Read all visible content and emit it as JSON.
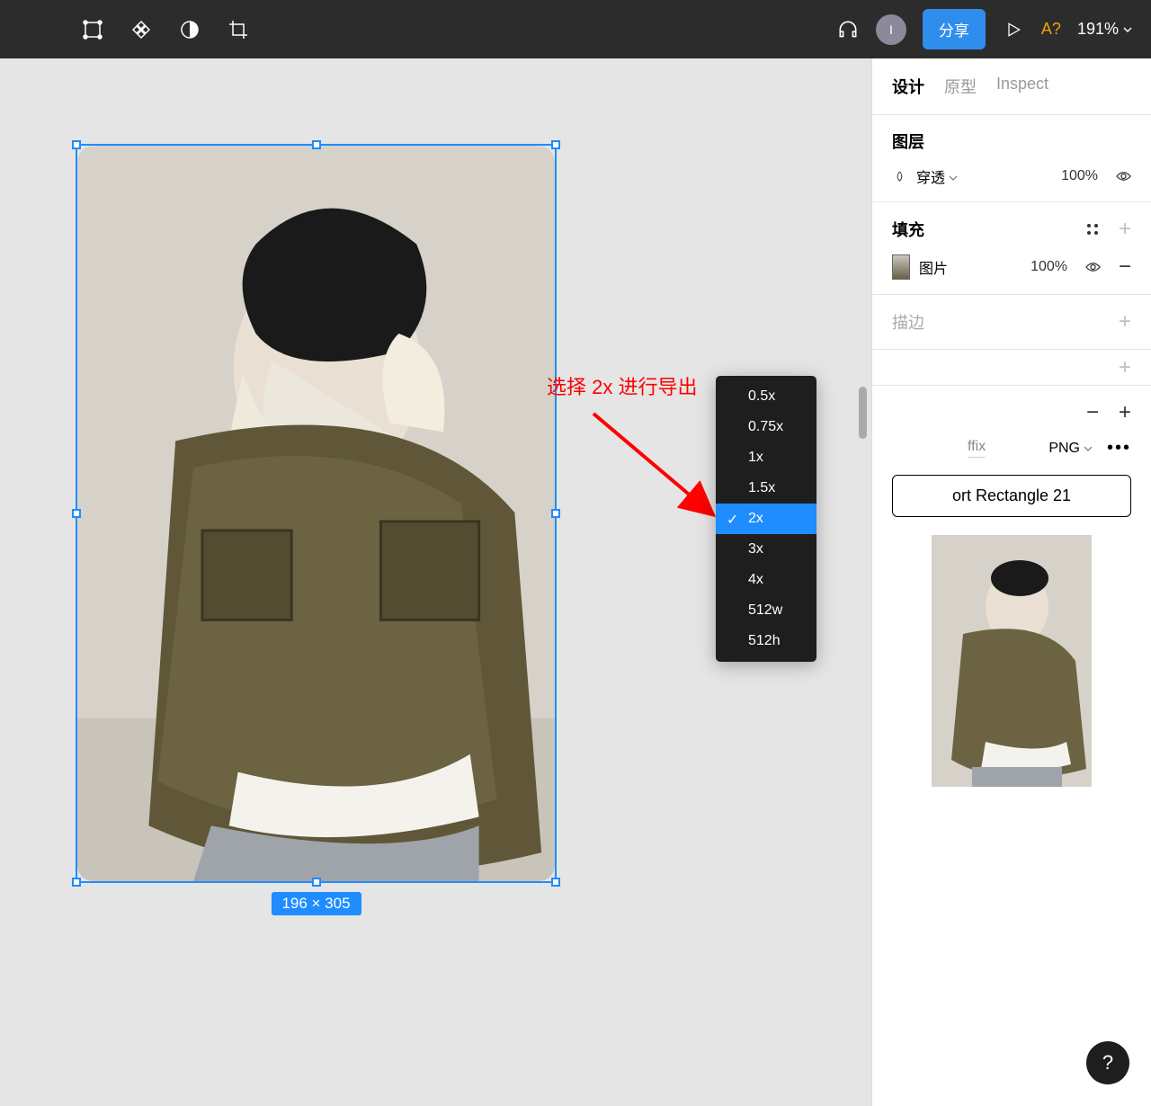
{
  "toolbar": {
    "avatar_initial": "I",
    "share_label": "分享",
    "missing_font": "A?",
    "zoom": "191%"
  },
  "tabs": {
    "design": "设计",
    "prototype": "原型",
    "inspect": "Inspect"
  },
  "layer": {
    "title": "图层",
    "blend_mode": "穿透",
    "opacity": "100%"
  },
  "fill": {
    "title": "填充",
    "type": "图片",
    "opacity": "100%"
  },
  "stroke": {
    "title": "描边"
  },
  "export": {
    "minus": "−",
    "plus": "+",
    "suffix": "ffix",
    "format": "PNG",
    "button": "ort Rectangle 21"
  },
  "dropdown": {
    "options": [
      "0.5x",
      "0.75x",
      "1x",
      "1.5x",
      "2x",
      "3x",
      "4x",
      "512w",
      "512h"
    ],
    "selected": "2x"
  },
  "annotation": "选择 2x 进行导出",
  "canvas": {
    "dimensions": "196 × 305"
  },
  "help": "?"
}
